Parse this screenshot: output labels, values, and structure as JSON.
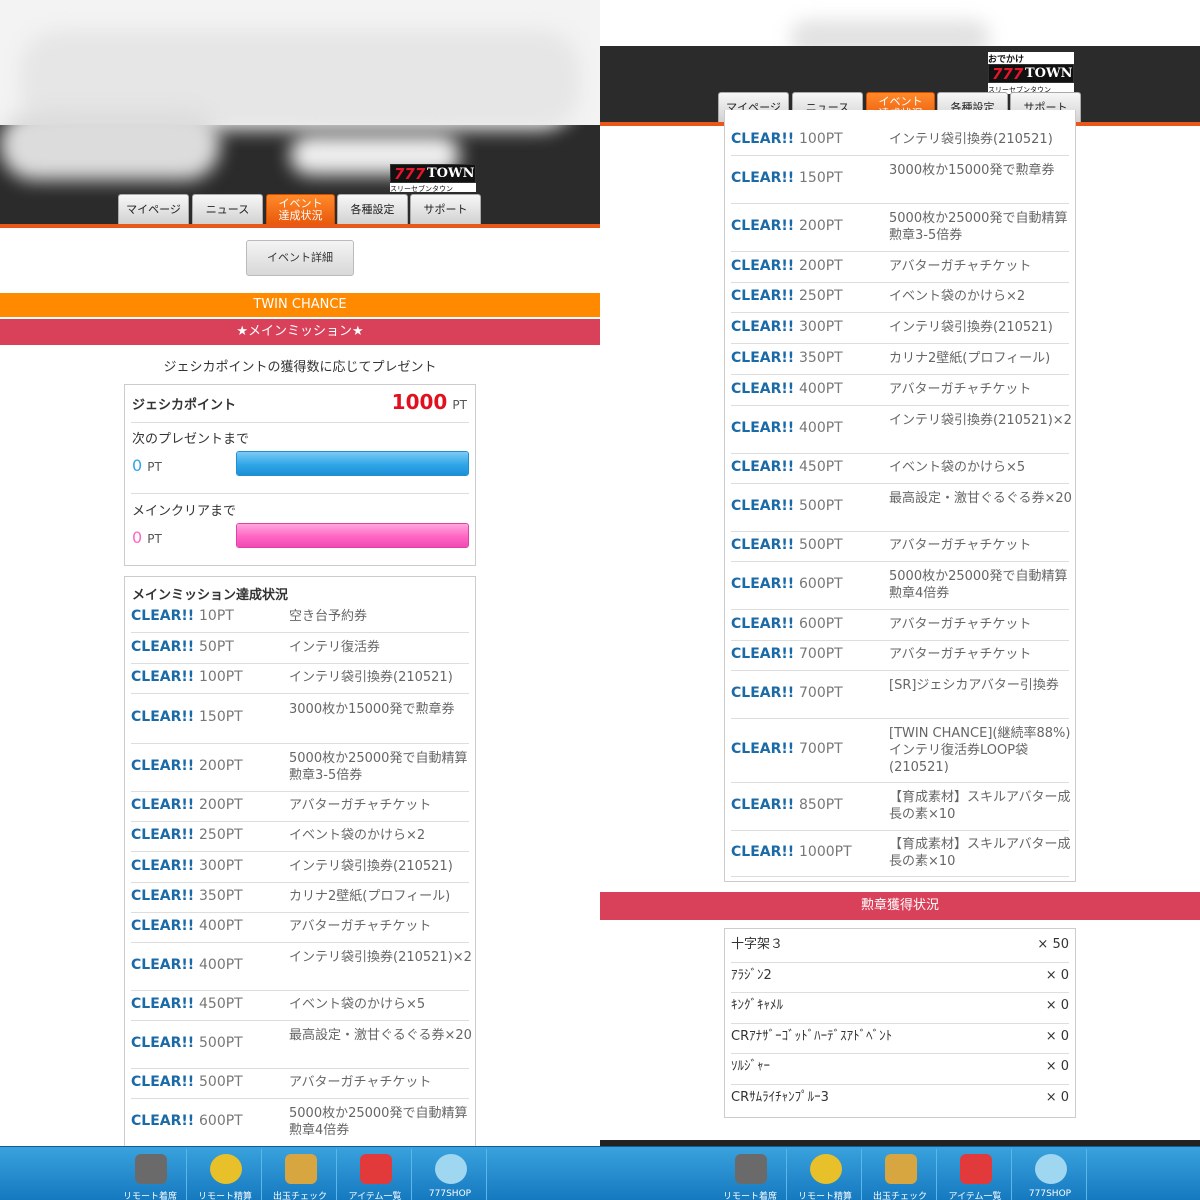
{
  "header": {
    "logo_top": "おでかけ",
    "logo_main_num": "777",
    "logo_main_word": "TOWN",
    "logo_sub": "スリーセブンタウン"
  },
  "tabs": [
    {
      "label": "マイページ"
    },
    {
      "label": "ニュース"
    },
    {
      "label_line1": "イベント",
      "label_line2": "達成状況",
      "active": true
    },
    {
      "label": "各種設定"
    },
    {
      "label": "サポート"
    }
  ],
  "event_detail_button": "イベント詳細",
  "twin_chance_label": "TWIN CHANCE",
  "main_mission_heading": "★メインミッション★",
  "present_description": "ジェシカポイントの獲得数に応じてプレゼント",
  "points": {
    "label": "ジェシカポイント",
    "value": "1000",
    "unit": "PT",
    "next_label": "次のプレゼントまで",
    "next_value": "0",
    "next_unit": "PT",
    "next_bar_fill": 1.0,
    "clear_label": "メインクリアまで",
    "clear_value": "0",
    "clear_unit": "PT",
    "clear_bar_fill": 1.0
  },
  "mission_status_title": "メインミッション達成状況",
  "missions": [
    {
      "status": "CLEAR!!",
      "points": "10PT",
      "reward": "空き台予約券"
    },
    {
      "status": "CLEAR!!",
      "points": "50PT",
      "reward": "インテリ復活券"
    },
    {
      "status": "CLEAR!!",
      "points": "100PT",
      "reward": "インテリ袋引換券(210521)"
    },
    {
      "status": "CLEAR!!",
      "points": "150PT",
      "reward": "3000枚か15000発で勲章券"
    },
    {
      "status": "CLEAR!!",
      "points": "200PT",
      "reward": "5000枚か25000発で自動精算勲章3-5倍券"
    },
    {
      "status": "CLEAR!!",
      "points": "200PT",
      "reward": "アバターガチャチケット"
    },
    {
      "status": "CLEAR!!",
      "points": "250PT",
      "reward": "イベント袋のかけら×2"
    },
    {
      "status": "CLEAR!!",
      "points": "300PT",
      "reward": "インテリ袋引換券(210521)"
    },
    {
      "status": "CLEAR!!",
      "points": "350PT",
      "reward": "カリナ2壁紙(プロフィール)"
    },
    {
      "status": "CLEAR!!",
      "points": "400PT",
      "reward": "アバターガチャチケット"
    },
    {
      "status": "CLEAR!!",
      "points": "400PT",
      "reward": "インテリ袋引換券(210521)×2"
    },
    {
      "status": "CLEAR!!",
      "points": "450PT",
      "reward": "イベント袋のかけら×5"
    },
    {
      "status": "CLEAR!!",
      "points": "500PT",
      "reward": "最高設定・激甘ぐるぐる券×20"
    },
    {
      "status": "CLEAR!!",
      "points": "500PT",
      "reward": "アバターガチャチケット"
    },
    {
      "status": "CLEAR!!",
      "points": "600PT",
      "reward": "5000枚か25000発で自動精算勲章4倍券"
    },
    {
      "status": "CLEAR!!",
      "points": "600PT",
      "reward": "アバターガチャチケット"
    },
    {
      "status": "CLEAR!!",
      "points": "700PT",
      "reward": "アバターガチャチケット"
    },
    {
      "status": "CLEAR!!",
      "points": "700PT",
      "reward": "[SR]ジェシカアバター引換券"
    },
    {
      "status": "CLEAR!!",
      "points": "700PT",
      "reward": "[TWIN CHANCE](継続率88%)インテリ復活券LOOP袋(210521)"
    },
    {
      "status": "CLEAR!!",
      "points": "850PT",
      "reward": "【育成素材】スキルアバター成長の素×10"
    },
    {
      "status": "CLEAR!!",
      "points": "1000PT",
      "reward": "【育成素材】スキルアバター成長の素×10"
    }
  ],
  "medal_heading": "勲章獲得状況",
  "medals": [
    {
      "name": "十字架３",
      "count": "× 50"
    },
    {
      "name": "ｱﾗｼﾞﾝ2",
      "count": "× 0"
    },
    {
      "name": "ｷﾝｸﾞｷｬﾒﾙ",
      "count": "× 0"
    },
    {
      "name": "CRｱﾅｻﾞｰｺﾞｯﾄﾞﾊｰﾃﾞｽｱﾄﾞﾍﾞﾝﾄ",
      "count": "× 0"
    },
    {
      "name": "ｿﾙｼﾞｬｰ",
      "count": "× 0"
    },
    {
      "name": "CRｻﾑﾗｲﾁｬﾝﾌﾟﾙｰ3",
      "count": "× 0"
    }
  ],
  "bottom_nav": [
    {
      "label": "リモート着席",
      "icon": "chair-icon"
    },
    {
      "label": "リモート精算",
      "icon": "medal-icon"
    },
    {
      "label": "出玉チェック",
      "icon": "coins-icon"
    },
    {
      "label": "アイテム一覧",
      "icon": "item-card-icon"
    },
    {
      "label": "777SHOP",
      "icon": "mascot-icon"
    }
  ],
  "colors": {
    "clear": "#1b6aa8",
    "points_value": "#e01020",
    "next_bar": "#2fa6e8",
    "clear_bar": "#ff66c4",
    "twin_chance_band": "#ff8a00",
    "mission_band": "#d9415a",
    "tab_active": "#f26a10"
  }
}
